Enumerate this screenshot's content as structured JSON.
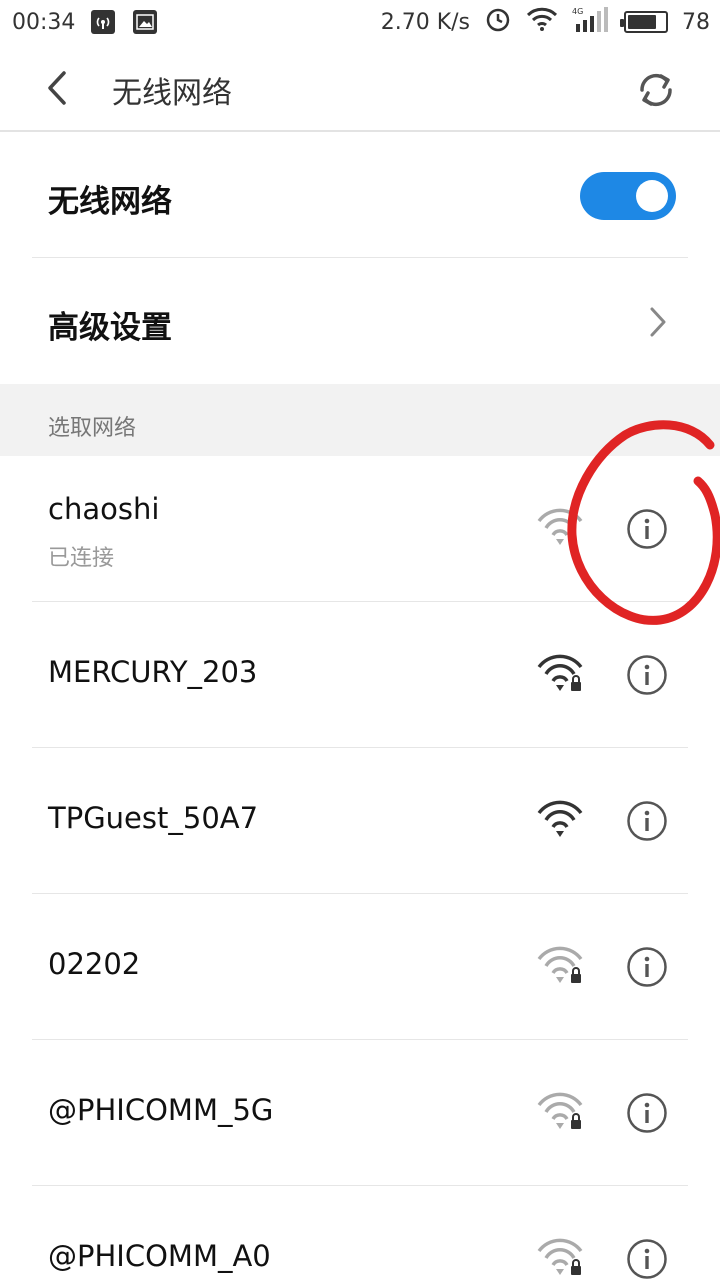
{
  "status_bar": {
    "time": "00:34",
    "speed": "2.70 K/s",
    "network_type": "4G",
    "battery_percent": "78",
    "battery_level": 0.78
  },
  "header": {
    "title": "无线网络",
    "back_icon": "chevron-left-icon",
    "refresh_icon": "refresh-icon"
  },
  "wifi_toggle": {
    "label": "无线网络",
    "enabled": true,
    "accent": "#1e88e5"
  },
  "advanced": {
    "label": "高级设置"
  },
  "section": {
    "label": "选取网络"
  },
  "networks": [
    {
      "name": "chaoshi",
      "status": "已连接",
      "locked": false
    },
    {
      "name": "MERCURY_203",
      "status": "",
      "locked": true
    },
    {
      "name": "TPGuest_50A7",
      "status": "",
      "locked": false
    },
    {
      "name": "02202",
      "status": "",
      "locked": true
    },
    {
      "name": "@PHICOMM_5G",
      "status": "",
      "locked": true
    },
    {
      "name": "@PHICOMM_A0",
      "status": "",
      "locked": true
    }
  ],
  "annotation_color": "#e02424"
}
